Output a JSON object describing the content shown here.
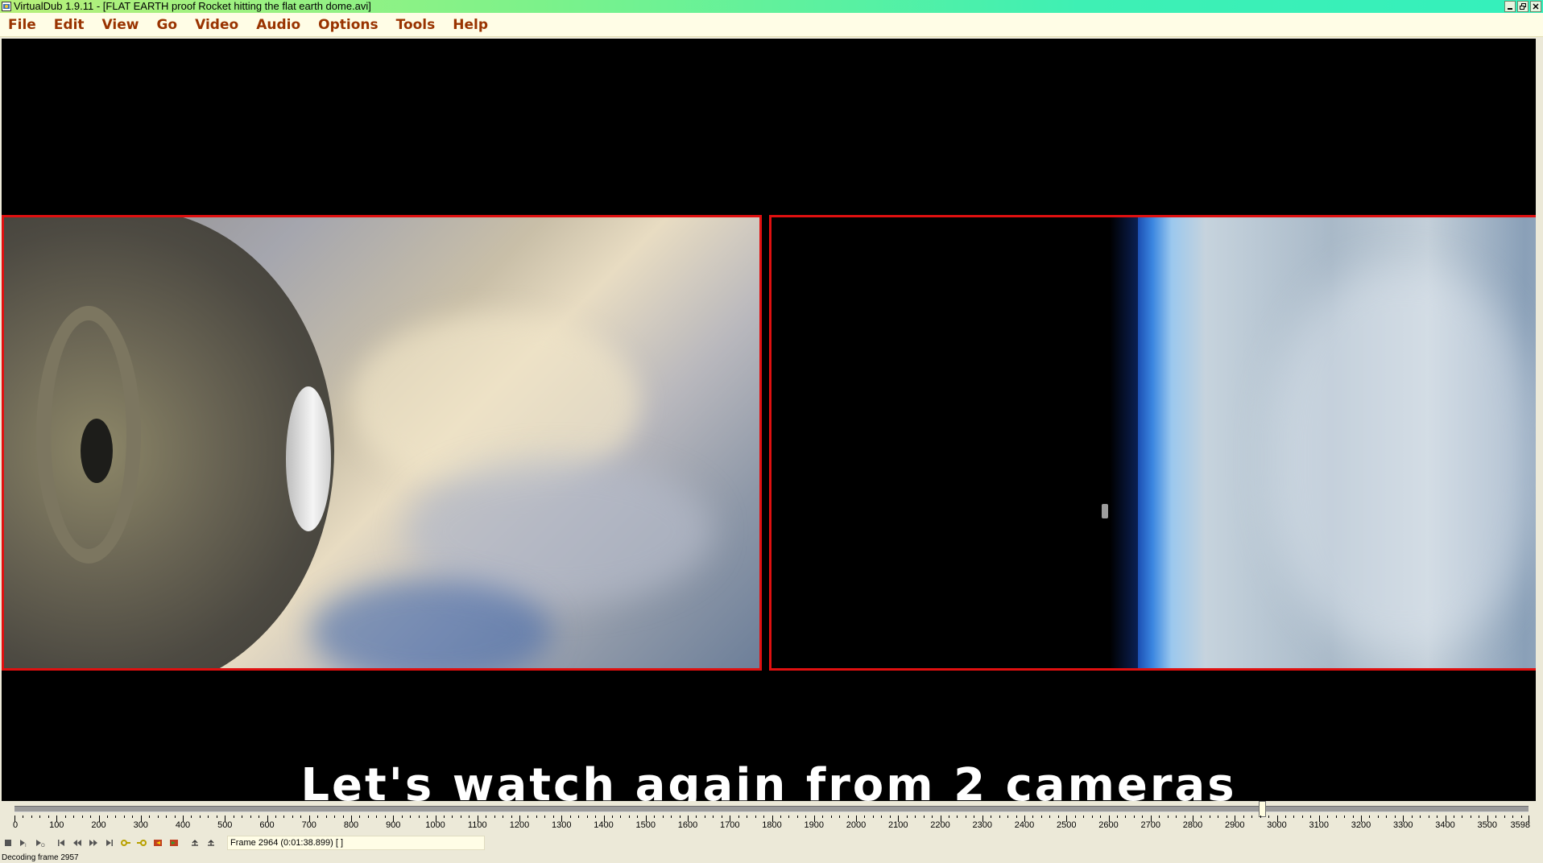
{
  "window": {
    "title": "VirtualDub 1.9.11 - [FLAT EARTH proof Rocket hitting the flat earth dome.avi]",
    "buttons": [
      "minimize",
      "restore",
      "close"
    ]
  },
  "menu": [
    "File",
    "Edit",
    "View",
    "Go",
    "Video",
    "Audio",
    "Options",
    "Tools",
    "Help"
  ],
  "video": {
    "caption": "Let's watch again from 2 cameras"
  },
  "timeline": {
    "min": 0,
    "max": 3598,
    "current_frame": 2964,
    "labels": [
      "0",
      "100",
      "200",
      "300",
      "400",
      "500",
      "600",
      "700",
      "800",
      "900",
      "1000",
      "1100",
      "1200",
      "1300",
      "1400",
      "1500",
      "1600",
      "1700",
      "1800",
      "1900",
      "2000",
      "2100",
      "2200",
      "2300",
      "2400",
      "2500",
      "2600",
      "2700",
      "2800",
      "2900",
      "3000",
      "3100",
      "3200",
      "3300",
      "3400",
      "3500",
      "3598"
    ]
  },
  "toolbar": {
    "buttons": [
      "stop-icon",
      "play-input-icon",
      "play-output-icon",
      "start-icon",
      "prev-frame-icon",
      "next-frame-icon",
      "end-icon",
      "prev-key-icon",
      "next-key-icon",
      "prev-scene-icon",
      "next-scene-icon",
      "mark-in-icon",
      "mark-out-icon"
    ],
    "frame_display": "Frame 2964 (0:01:38.899) [ ]"
  },
  "status": {
    "text": "Decoding frame 2957"
  },
  "colors": {
    "title_gradient_start": "#b8f07a",
    "title_gradient_end": "#34f0bc",
    "menu_bg": "#fffde6",
    "menu_text": "#993300",
    "frame_border": "#e01010"
  }
}
